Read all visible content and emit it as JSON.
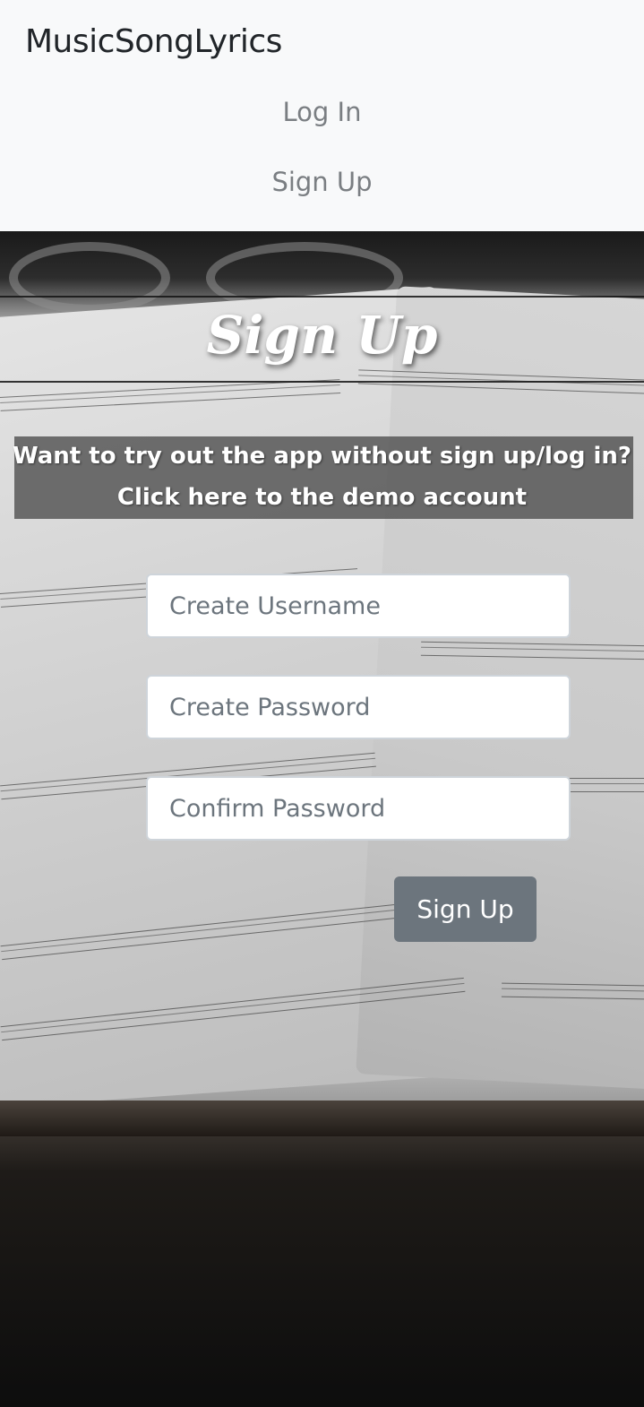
{
  "navbar": {
    "brand": "MusicSongLyrics",
    "links": [
      "Log In",
      "Sign Up"
    ]
  },
  "page": {
    "title": "Sign Up",
    "demo_line_1": "Want to try out the app without sign up/log in?",
    "demo_line_2": "Click here to the demo account"
  },
  "form": {
    "username_placeholder": "Create Username",
    "password_placeholder": "Create Password",
    "confirm_placeholder": "Confirm Password",
    "submit_label": "Sign Up"
  },
  "colors": {
    "navbar_bg": "#f8f9fa",
    "nav_link": "#7a7e82",
    "button_bg": "#6c757d",
    "demo_box_bg": "#4b4b4b"
  }
}
